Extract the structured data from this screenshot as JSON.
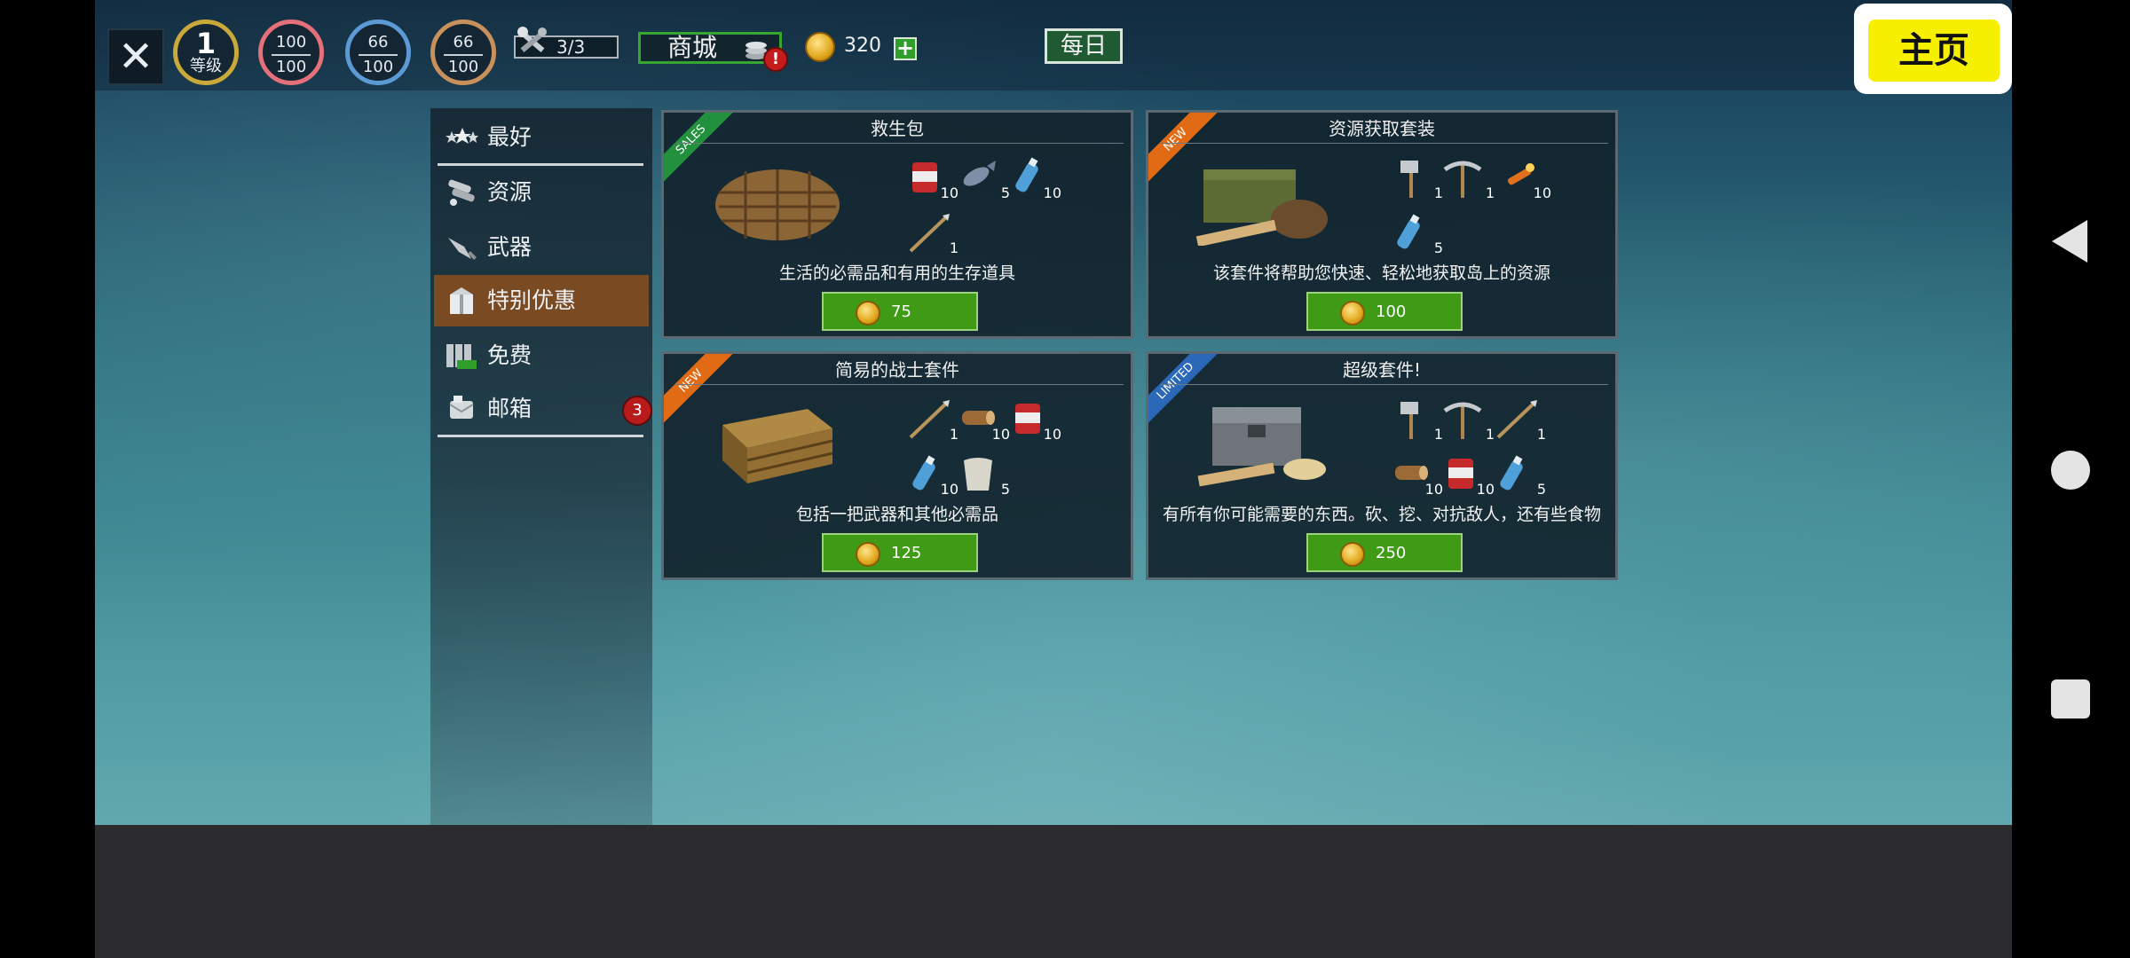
{
  "topbar": {
    "level": {
      "value": "1",
      "label": "等级"
    },
    "health": {
      "current": "100",
      "max": "100"
    },
    "water": {
      "current": "66",
      "max": "100"
    },
    "food": {
      "current": "66",
      "max": "100"
    },
    "tools": "3/3",
    "shop_label": "商城",
    "shop_badge": "!",
    "gold": "320",
    "daily_label": "每日",
    "home_label": "主页"
  },
  "sidebar": {
    "items": [
      {
        "label": "最好",
        "icon": "stars-icon"
      },
      {
        "label": "资源",
        "icon": "resources-icon"
      },
      {
        "label": "武器",
        "icon": "weapon-icon"
      },
      {
        "label": "特别优惠",
        "icon": "gift-box-icon",
        "active": true
      },
      {
        "label": "免费",
        "icon": "free-icon"
      },
      {
        "label": "邮箱",
        "icon": "mailbox-icon",
        "badge": "3"
      }
    ]
  },
  "offers": [
    {
      "title": "救生包",
      "ribbon": "SALES",
      "description": "生活的必需品和有用的生存道具",
      "price": "75",
      "items": [
        {
          "icon": "canned-food-icon",
          "count": "10"
        },
        {
          "icon": "fish-icon",
          "count": "5"
        },
        {
          "icon": "water-bottle-icon",
          "count": "10"
        },
        {
          "icon": "spear-icon",
          "count": "1"
        }
      ]
    },
    {
      "title": "资源获取套装",
      "ribbon": "NEW",
      "description": "该套件将帮助您快速、轻松地获取岛上的资源",
      "price": "100",
      "items": [
        {
          "icon": "axe-icon",
          "count": "1"
        },
        {
          "icon": "pickaxe-icon",
          "count": "1"
        },
        {
          "icon": "flare-icon",
          "count": "10"
        },
        {
          "icon": "water-bottle-icon",
          "count": "5"
        }
      ]
    },
    {
      "title": "简易的战士套件",
      "ribbon": "NEW",
      "description": "包括一把武器和其他必需品",
      "price": "125",
      "items": [
        {
          "icon": "spear-icon",
          "count": "1"
        },
        {
          "icon": "log-icon",
          "count": "10"
        },
        {
          "icon": "canned-food-icon",
          "count": "10"
        },
        {
          "icon": "water-bottle-icon",
          "count": "10"
        },
        {
          "icon": "cloth-icon",
          "count": "5"
        }
      ]
    },
    {
      "title": "超级套件!",
      "ribbon": "LIMITED",
      "description": "有所有你可能需要的东西。砍、挖、对抗敌人，还有些食物",
      "price": "250",
      "items": [
        {
          "icon": "axe-icon",
          "count": "1"
        },
        {
          "icon": "pickaxe-icon",
          "count": "1"
        },
        {
          "icon": "spear-icon",
          "count": "1"
        },
        {
          "icon": "log-icon",
          "count": "10"
        },
        {
          "icon": "canned-food-icon",
          "count": "10"
        },
        {
          "icon": "water-bottle-icon",
          "count": "5"
        }
      ]
    }
  ],
  "colors": {
    "active_tab": "#7a4a23",
    "price_button": "#3f9a15",
    "home_button": "#f6f000",
    "sales_ribbon": "#22913e",
    "new_ribbon": "#e06b14",
    "limited_ribbon": "#2b69b8"
  }
}
